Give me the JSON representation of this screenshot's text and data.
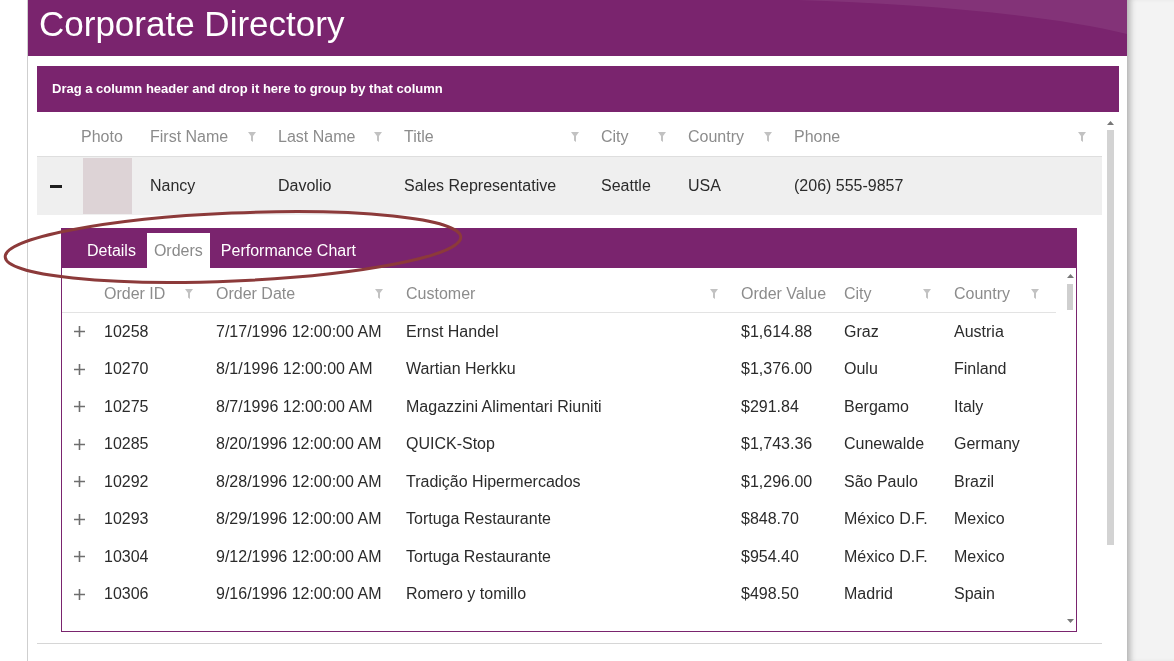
{
  "window": {
    "title": "Corporate Directory"
  },
  "group_panel": {
    "hint": "Drag a column header and drop it here to group by that column"
  },
  "employees": {
    "columns": [
      {
        "label": "Photo",
        "filter": false
      },
      {
        "label": "First Name",
        "filter": true
      },
      {
        "label": "Last Name",
        "filter": true
      },
      {
        "label": "Title",
        "filter": true
      },
      {
        "label": "City",
        "filter": true
      },
      {
        "label": "Country",
        "filter": true
      },
      {
        "label": "Phone",
        "filter": true
      }
    ],
    "rows": [
      {
        "expanded": true,
        "cells": [
          {
            "kind": "photo"
          },
          {
            "kind": "text",
            "text": "Nancy"
          },
          {
            "kind": "text",
            "text": "Davolio"
          },
          {
            "kind": "text",
            "text": "Sales Representative"
          },
          {
            "kind": "text",
            "text": "Seattle"
          },
          {
            "kind": "text",
            "text": "USA"
          },
          {
            "kind": "text",
            "text": "(206) 555-9857"
          }
        ],
        "details": {
          "tabs": [
            {
              "label": "Details",
              "selected": false
            },
            {
              "label": "Orders",
              "selected": true
            },
            {
              "label": "Performance Chart",
              "selected": false
            }
          ],
          "orders": {
            "columns": [
              {
                "label": "Order ID",
                "filter": true
              },
              {
                "label": "Order Date",
                "filter": true
              },
              {
                "label": "Customer",
                "filter": true
              },
              {
                "label": "Order Value",
                "filter": false
              },
              {
                "label": "City",
                "filter": true
              },
              {
                "label": "Country",
                "filter": true
              }
            ],
            "rows": [
              {
                "expanded": false,
                "cells": [
                  "10258",
                  "7/17/1996 12:00:00 AM",
                  "Ernst Handel",
                  "$1,614.88",
                  "Graz",
                  "Austria"
                ]
              },
              {
                "expanded": false,
                "cells": [
                  "10270",
                  "8/1/1996 12:00:00 AM",
                  "Wartian Herkku",
                  "$1,376.00",
                  "Oulu",
                  "Finland"
                ]
              },
              {
                "expanded": false,
                "cells": [
                  "10275",
                  "8/7/1996 12:00:00 AM",
                  "Magazzini Alimentari Riuniti",
                  "$291.84",
                  "Bergamo",
                  "Italy"
                ]
              },
              {
                "expanded": false,
                "cells": [
                  "10285",
                  "8/20/1996 12:00:00 AM",
                  "QUICK-Stop",
                  "$1,743.36",
                  "Cunewalde",
                  "Germany"
                ]
              },
              {
                "expanded": false,
                "cells": [
                  "10292",
                  "8/28/1996 12:00:00 AM",
                  "Tradição Hipermercados",
                  "$1,296.00",
                  "São Paulo",
                  "Brazil"
                ]
              },
              {
                "expanded": false,
                "cells": [
                  "10293",
                  "8/29/1996 12:00:00 AM",
                  "Tortuga Restaurante",
                  "$848.70",
                  "México D.F.",
                  "Mexico"
                ]
              },
              {
                "expanded": false,
                "cells": [
                  "10304",
                  "9/12/1996 12:00:00 AM",
                  "Tortuga Restaurante",
                  "$954.40",
                  "México D.F.",
                  "Mexico"
                ]
              },
              {
                "expanded": false,
                "cells": [
                  "10306",
                  "9/16/1996 12:00:00 AM",
                  "Romero y tomillo",
                  "$498.50",
                  "Madrid",
                  "Spain"
                ]
              }
            ]
          }
        }
      }
    ]
  }
}
